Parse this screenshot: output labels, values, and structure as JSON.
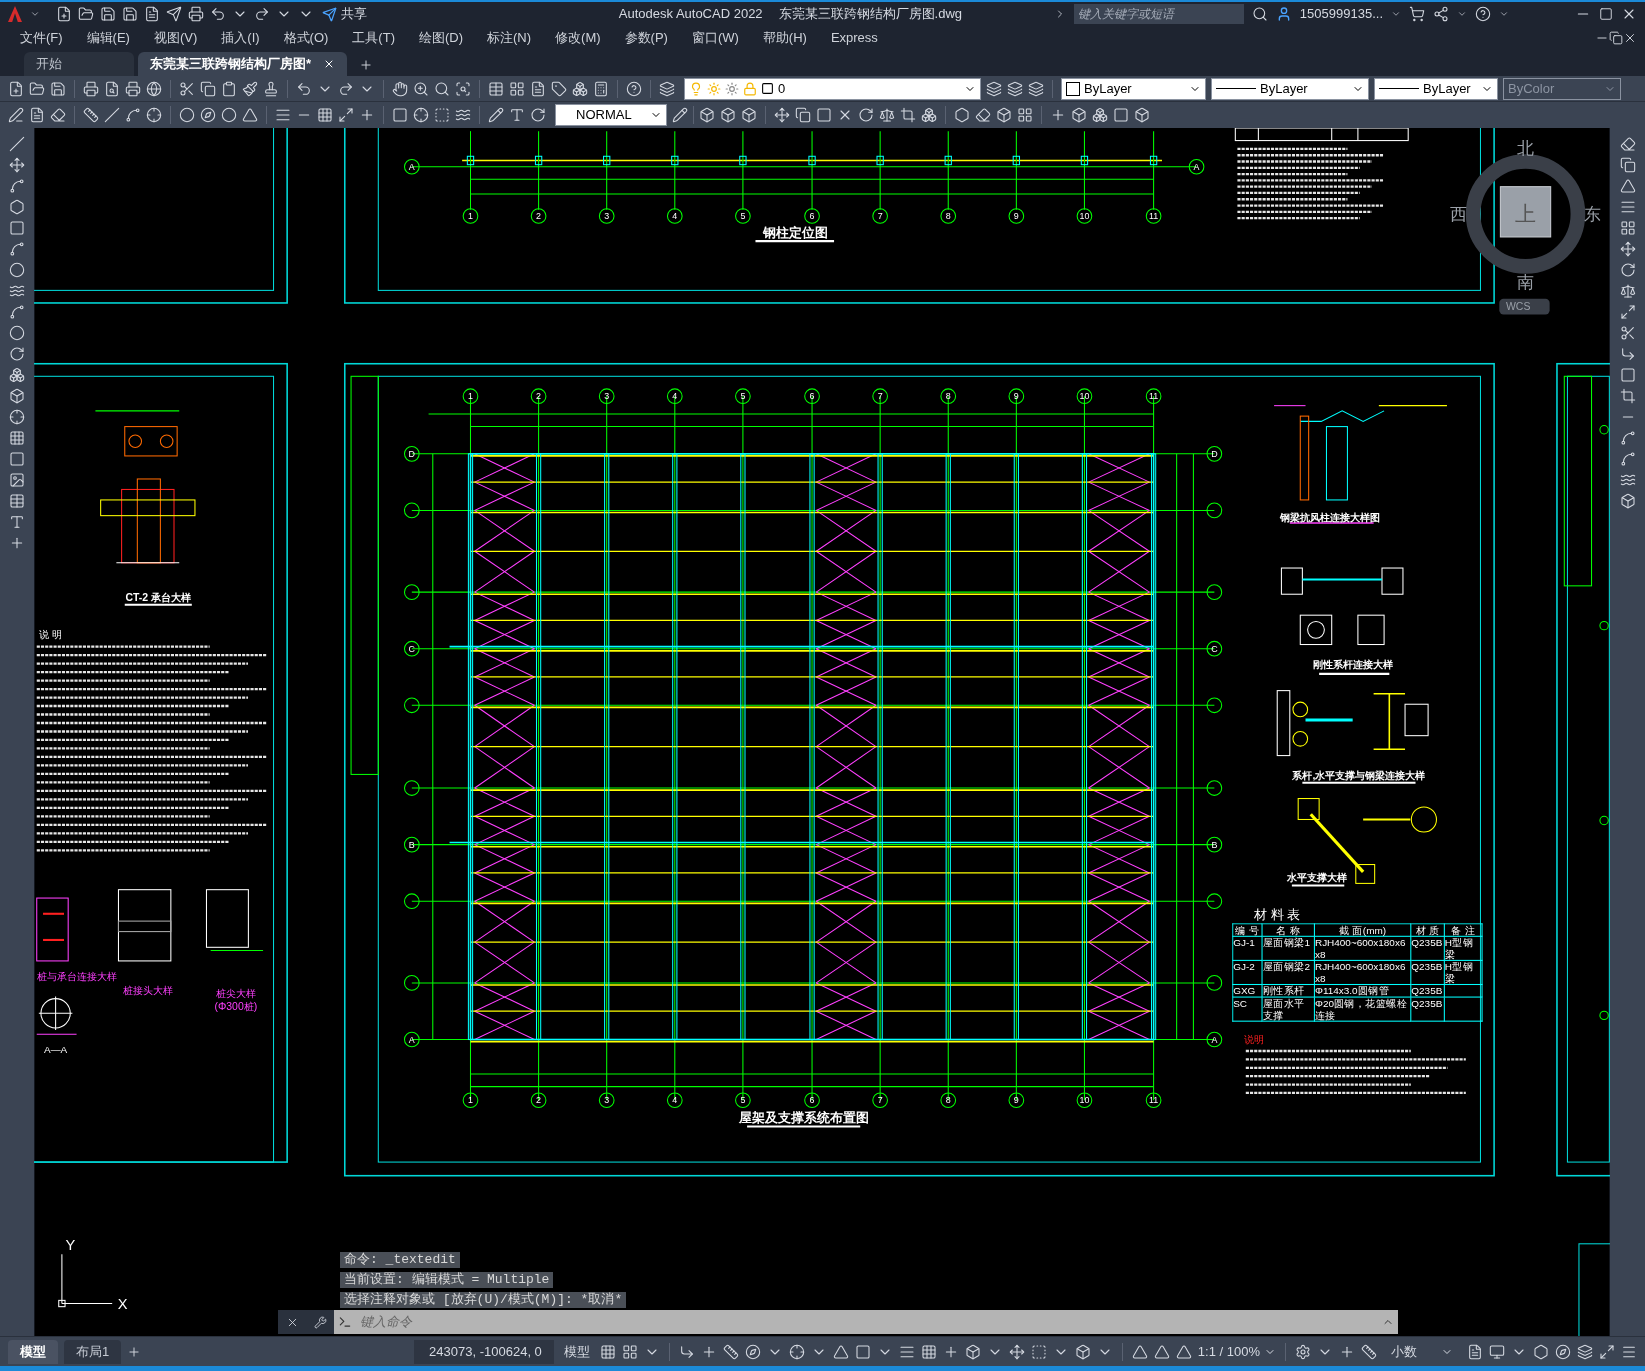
{
  "title_bar": {
    "share": "共享",
    "app_title": "Autodesk AutoCAD 2022",
    "file_title": "东莞某三联跨钢结构厂房图.dwg",
    "search": {
      "placeholder": "键入关键字或短语"
    },
    "user": "1505999135..."
  },
  "menu": [
    "文件(F)",
    "编辑(E)",
    "视图(V)",
    "插入(I)",
    "格式(O)",
    "工具(T)",
    "绘图(D)",
    "标注(N)",
    "修改(M)",
    "参数(P)",
    "窗口(W)",
    "帮助(H)",
    "Express"
  ],
  "doc_tabs": [
    {
      "label": "开始",
      "selected": false
    },
    {
      "label": "东莞某三联跨钢结构厂房图*",
      "selected": true
    }
  ],
  "toolbar": {
    "layer": "0",
    "text_style": "NORMAL",
    "color_control": "ByLayer",
    "linetype": "ByLayer",
    "lineweight": "ByLayer",
    "plot_style": {
      "value": "ByColor",
      "disabled": true
    }
  },
  "viewcube": {
    "north": "北",
    "south": "南",
    "west": "西",
    "east": "东",
    "face": "上",
    "coordinate_system": "WCS"
  },
  "drawing": {
    "top_plan": {
      "title": "钢柱定位图",
      "row_labels": [
        "A",
        "A"
      ],
      "column_axes": [
        "1",
        "2",
        "3",
        "4",
        "5",
        "6",
        "7",
        "8",
        "9",
        "10",
        "11"
      ]
    },
    "left_panel": {
      "detail_title": "CT-2 承台大样",
      "notes_heading": "说  明",
      "detail_titles": [
        "桩与承台连接大样",
        "桩接头大样",
        "桩尖大样",
        "(Φ300桩)",
        "A—A"
      ]
    },
    "main_plan": {
      "title": "屋架及支撑系统布置图",
      "top_axes": [
        "1",
        "2",
        "3",
        "4",
        "5",
        "6",
        "7",
        "8",
        "9",
        "10",
        "11"
      ],
      "bottom_axes": [
        "1",
        "2",
        "3",
        "4",
        "5",
        "6",
        "7",
        "8",
        "9",
        "10",
        "11"
      ],
      "left_axes": [
        "D",
        "C",
        "B",
        "A"
      ],
      "right_axes": [
        "D",
        "C",
        "B",
        "A"
      ]
    },
    "detail_titles": [
      "钢梁抗风柱连接大样图",
      "刚性系杆连接大样",
      "系杆,水平支撑与钢梁连接大样",
      "水平支撑大样"
    ],
    "material_table": {
      "title": "材 料 表",
      "columns": [
        "编 号",
        "名 称",
        "截 面(mm)",
        "材 质",
        "备 注"
      ],
      "rows": [
        [
          "GJ-1",
          "屋面钢梁1",
          "RJH400~600x180x6x8",
          "Q235B",
          "H型钢梁"
        ],
        [
          "GJ-2",
          "屋面钢梁2",
          "RJH400~600x180x6x8",
          "Q235B",
          "H型钢梁"
        ],
        [
          "GXG",
          "刚性系杆",
          "Φ114x3.0圆钢管",
          "Q235B",
          ""
        ],
        [
          "SC",
          "屋面水平支撑",
          "Φ20圆钢，花篮螺栓连接",
          "Q235B",
          ""
        ]
      ]
    },
    "notes_heading": "说明"
  },
  "ucs": {
    "y": "Y",
    "x": "X"
  },
  "command_history": [
    "命令: _textedit",
    "当前设置: 编辑模式 = Multiple",
    "选择注释对象或 [放弃(U)/模式(M)]: *取消*"
  ],
  "command_input": {
    "placeholder": "键入命令"
  },
  "layout_tabs": [
    {
      "label": "模型",
      "selected": true
    },
    {
      "label": "布局1",
      "selected": false
    }
  ],
  "status_bar": {
    "coordinates": "243073, -100624, 0",
    "space": "模型",
    "annotation_scale": "1:1 / 100%",
    "units": "小数"
  }
}
